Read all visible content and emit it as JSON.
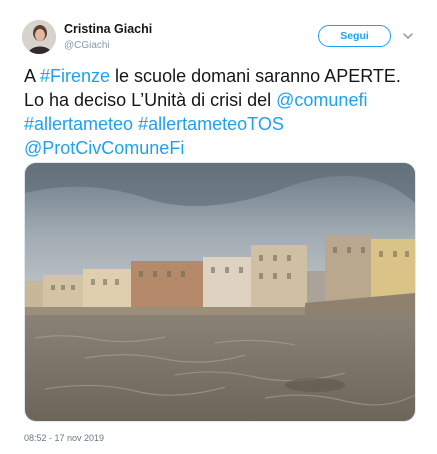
{
  "author": {
    "name": "Cristina Giachi",
    "handle": "@CGiachi"
  },
  "follow_button": {
    "label": "Segui"
  },
  "icons": {
    "menu": "chevron-down-icon"
  },
  "tweet": {
    "line1": {
      "a": "A ",
      "link": "#Firenze",
      "b": " le scuole domani saranno APERTE."
    },
    "line2": {
      "a": "Lo ha deciso L’Unità di crisi del ",
      "link": "@comunefi"
    },
    "line3": {
      "link1": "#allertameteo",
      "sep": " ",
      "link2": "#allertameteoTOS"
    },
    "line4": {
      "link": "@ProtCivComuneFi"
    }
  },
  "timestamp": "08:52 - 17 nov 2019",
  "colors": {
    "accent": "#1da1f2",
    "text": "#14171a",
    "secondary": "#657786"
  }
}
